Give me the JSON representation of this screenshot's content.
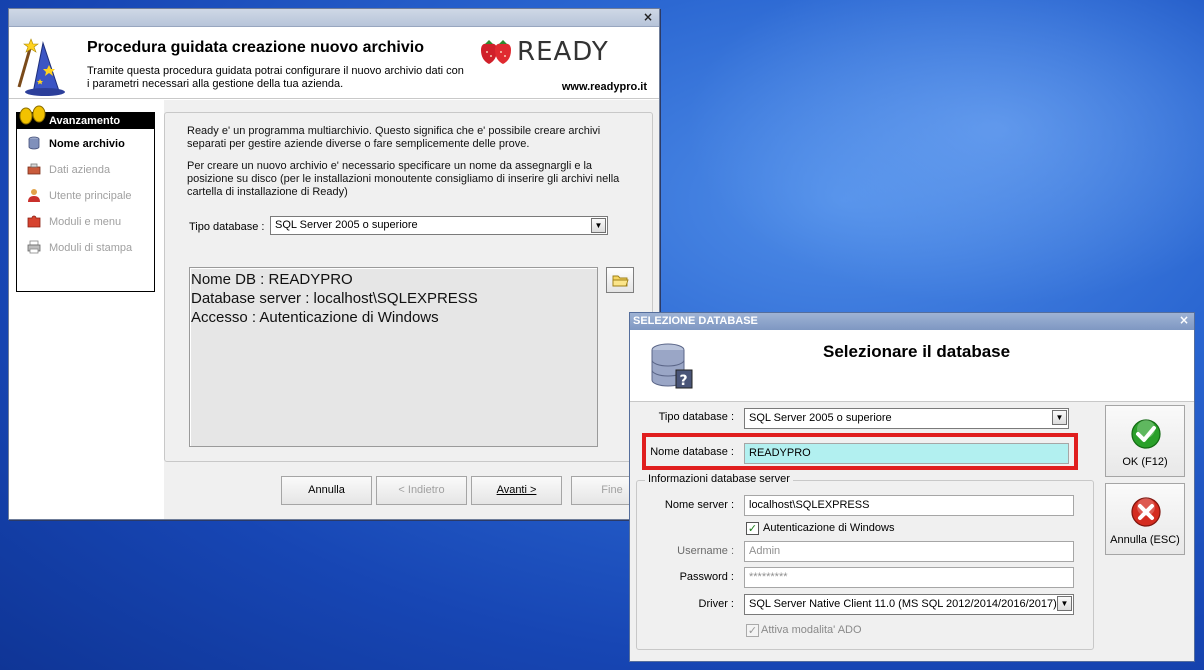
{
  "wizard": {
    "title": "Procedura guidata creazione nuovo archivio",
    "subtitle": "Tramite questa procedura guidata potrai configurare il nuovo archivio dati con i parametri necessari alla gestione della tua azienda.",
    "brand": "READY",
    "url": "www.readypro.it",
    "close_glyph": "×",
    "steps_header": "Avanzamento",
    "steps": [
      {
        "label": "Nome archivio",
        "icon": "database-icon",
        "active": true
      },
      {
        "label": "Dati azienda",
        "icon": "company-icon",
        "active": false
      },
      {
        "label": "Utente principale",
        "icon": "user-icon",
        "active": false
      },
      {
        "label": "Moduli e menu",
        "icon": "puzzle-icon",
        "active": false
      },
      {
        "label": "Moduli di stampa",
        "icon": "printer-icon",
        "active": false
      }
    ],
    "info1": "Ready e' un programma multiarchivio. Questo significa che e' possibile creare archivi separati per gestire aziende diverse o fare semplicemente delle prove.",
    "info2": "Per creare un nuovo archivio e' necessario specificare un nome da assegnargli e la posizione su disco (per le installazioni monoutente consigliamo di inserire gli archivi nella cartella di installazione di Ready)",
    "db_type_label": "Tipo database :",
    "db_type_value": "SQL Server 2005 o superiore",
    "summary": [
      "Nome DB : READYPRO",
      "Database server : localhost\\SQLEXPRESS",
      "Accesso : Autenticazione di Windows"
    ],
    "buttons": {
      "cancel": "Annulla",
      "back": "< Indietro",
      "next": "Avanti >",
      "finish": "Fine"
    }
  },
  "db_dialog": {
    "title_bar": "SELEZIONE DATABASE",
    "close_glyph": "×",
    "heading": "Selezionare il database",
    "tipo_label": "Tipo database :",
    "tipo_value": "SQL Server 2005 o superiore",
    "nome_label": "Nome database :",
    "nome_value": "READYPRO",
    "group_title": "Informazioni database server",
    "server_label": "Nome server :",
    "server_value": "localhost\\SQLEXPRESS",
    "win_auth_label": "Autenticazione di Windows",
    "win_auth_checked": true,
    "username_label": "Username :",
    "username_value": "Admin",
    "password_label": "Password :",
    "password_value": "*********",
    "driver_label": "Driver :",
    "driver_value": "SQL Server Native Client 11.0 (MS SQL 2012/2014/2016/2017)",
    "ado_label": "Attiva modalita' ADO",
    "ado_checked": true,
    "ok_label": "OK (F12)",
    "cancel_label": "Annulla (ESC)",
    "check_glyph": "✓"
  },
  "colors": {
    "desktop": "#2a66d1",
    "highlight_border": "#e01e1e",
    "name_field_bg": "#b2f0f0",
    "ok_green": "#2aa02a",
    "cancel_red": "#d42c20"
  }
}
